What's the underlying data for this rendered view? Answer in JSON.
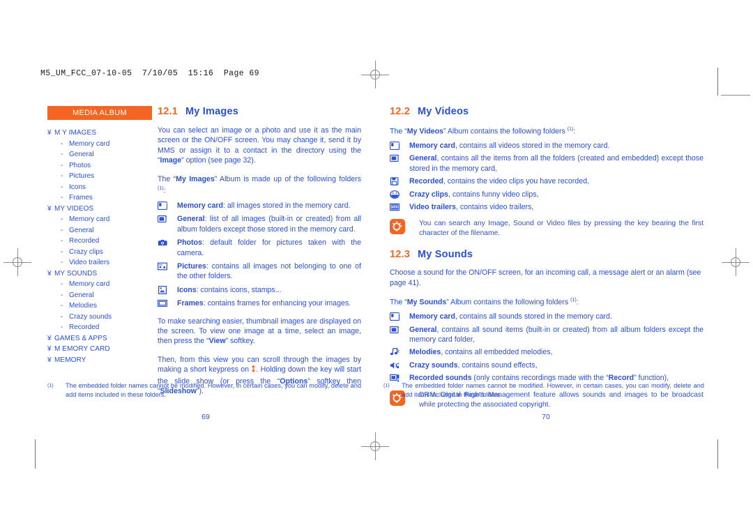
{
  "job_header": "M5_UM_FCC_07-10-05  7/10/05  15:16  Page 69",
  "colors": {
    "orange": "#f36522",
    "blue": "#2b4fd6",
    "mark_gray": "#8a8a8a"
  },
  "sidebar": {
    "tab_label": "MEDIA ALBUM",
    "arrow_glyph": "¥",
    "dash_glyph": "-",
    "items": [
      {
        "label": "M Y IMAGES",
        "level": "top"
      },
      {
        "label": "Memory card",
        "level": "sub"
      },
      {
        "label": "General",
        "level": "sub"
      },
      {
        "label": "Photos",
        "level": "sub"
      },
      {
        "label": "Pictures",
        "level": "sub"
      },
      {
        "label": "Icons",
        "level": "sub"
      },
      {
        "label": "Frames",
        "level": "sub"
      },
      {
        "label": "MY  VIDEOS",
        "level": "top"
      },
      {
        "label": "Memory card",
        "level": "sub"
      },
      {
        "label": "General",
        "level": "sub"
      },
      {
        "label": "Recorded",
        "level": "sub"
      },
      {
        "label": "Crazy clips",
        "level": "sub"
      },
      {
        "label": "Video trailers",
        "level": "sub"
      },
      {
        "label": "MY SOUNDS",
        "level": "top"
      },
      {
        "label": "Memory card",
        "level": "sub"
      },
      {
        "label": "General",
        "level": "sub"
      },
      {
        "label": "Melodies",
        "level": "sub"
      },
      {
        "label": "Crazy sounds",
        "level": "sub"
      },
      {
        "label": "Recorded",
        "level": "sub"
      },
      {
        "label": "GAMES & APPS",
        "level": "top"
      },
      {
        "label": "M EMORY CARD",
        "level": "top"
      },
      {
        "label": "MEMORY",
        "level": "top"
      }
    ]
  },
  "left_page": {
    "folio": "69",
    "section": {
      "number": "12.1",
      "title": "My Images"
    },
    "intro": "You can select an image or a photo and use it as the main screen or the ON/OFF screen. You may change it, send it by MMS or assign it to a contact in the directory using the “Image” option (see page 32).",
    "intro_bold": "Image",
    "lead": "The “My Images” Album is made up of the following folders",
    "lead_bold": "My Images",
    "lead_sup": "(1)",
    "lead_tail": ":",
    "folders": [
      {
        "icon": "memory-card-icon",
        "name": "Memory card",
        "desc": ": all images stored in the memory card."
      },
      {
        "icon": "general-folder-icon",
        "name": "General",
        "desc": ": list of all images (built-in or created) from all album folders except those stored in the memory card."
      },
      {
        "icon": "camera-icon",
        "name": "Photos",
        "desc": ": default folder for pictures taken with the camera."
      },
      {
        "icon": "pictures-icon",
        "name": "Pictures",
        "desc": ": contains all images not belonging to one of the other folders."
      },
      {
        "icon": "icons-stamps-icon",
        "name": "Icons",
        "desc": ": contains icons, stamps..."
      },
      {
        "icon": "frames-icon",
        "name": "Frames",
        "desc": ": contains frames for enhancing your images."
      }
    ],
    "para_view": "To make searching easier, thumbnail images are displayed on the screen. To view one image at a time, select an image, then press the “View” softkey.",
    "para_view_bold": "View",
    "para_scroll_1": "Then, from this view you can scroll through the images by making a short keypress on ",
    "para_scroll_2": ". Holding down the key will start the slide show (or press the “Options” softkey then “Slideshow”).",
    "para_scroll_bold_1": "Options",
    "para_scroll_bold_2": "Slideshow",
    "footnote_mark": "(1)",
    "footnote": "The embedded folder names cannot be modified. However, in certain cases, you can modify, delete and add items included in these folders."
  },
  "right_page": {
    "folio": "70",
    "videos": {
      "section": {
        "number": "12.2",
        "title": "My Videos"
      },
      "lead_pre": "The “",
      "lead_bold": "My Videos",
      "lead_post": "” Album contains the following folders",
      "lead_sup": "(1)",
      "lead_tail": ":",
      "folders": [
        {
          "icon": "memory-card-icon",
          "name": "Memory card",
          "desc": ", contains all videos stored in the memory card."
        },
        {
          "icon": "general-folder-icon",
          "name": "General",
          "desc": ", contains all the items from all the folders (created and embedded) except those stored in the memory card,"
        },
        {
          "icon": "recorded-video-icon",
          "name": "Recorded",
          "desc": ", contains the video clips you have recorded,"
        },
        {
          "icon": "crazy-clips-icon",
          "name": "Crazy clips",
          "desc": ", contains funny video clips,"
        },
        {
          "icon": "video-trailers-icon",
          "name": "Video trailers",
          "desc": ", contains video trailers,"
        }
      ],
      "tip": "You can search any Image, Sound or Video files by pressing the key bearing the first character of the filename."
    },
    "sounds": {
      "section": {
        "number": "12.3",
        "title": "My Sounds"
      },
      "intro": "Choose a sound for the ON/OFF screen, for an incoming call, a message alert or an alarm (see page 41).",
      "lead_pre": "The “",
      "lead_bold": "My Sounds",
      "lead_post": "” Album contains the following folders",
      "lead_sup": "(1)",
      "lead_tail": ":",
      "folders": [
        {
          "icon": "memory-card-icon",
          "name": "Memory card",
          "desc": ", contains all sounds stored in the memory card."
        },
        {
          "icon": "general-folder-icon",
          "name": "General",
          "desc": ", contains all sound items (built-in or created) from all album folders except the memory card folder,"
        },
        {
          "icon": "melodies-icon",
          "name": "Melodies",
          "desc": ", contains all embedded melodies,"
        },
        {
          "icon": "crazy-sounds-icon",
          "name": "Crazy sounds",
          "desc": ", contains sound effects,"
        },
        {
          "icon": "recorded-sounds-icon",
          "name": "Recorded sounds",
          "desc": " (only contains recordings made with the “Record” function),"
        }
      ],
      "tip": "DRM: Digital Rights Management feature allows sounds and images to be broadcast while protecting the associated copyright."
    },
    "footnote_mark": "(1)",
    "footnote": "The embedded folder names cannot be modified. However, in certain cases, you can modify, delete and add items included in these folders."
  }
}
